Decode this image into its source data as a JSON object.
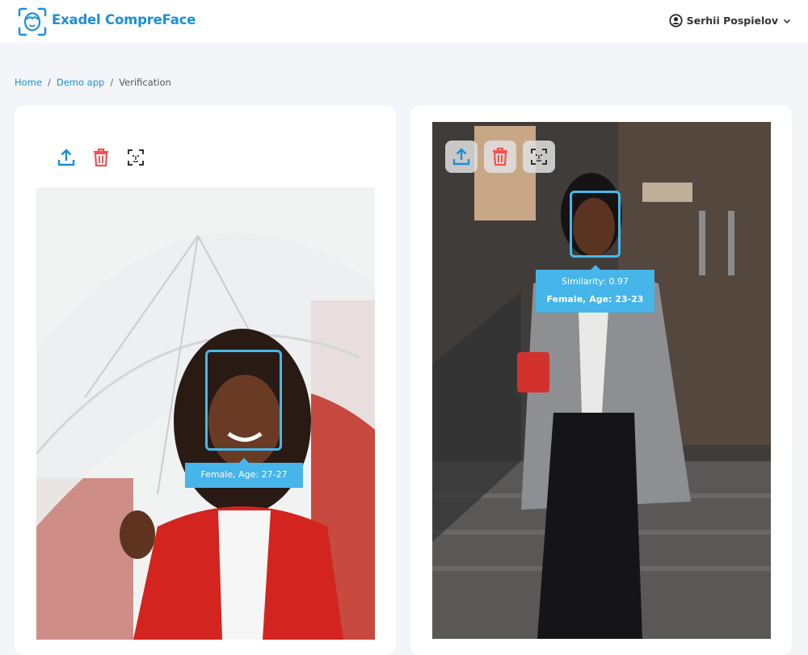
{
  "app": {
    "name": "Exadel CompreFace",
    "brand_color": "#1c8fd8"
  },
  "user": {
    "name": "Serhii Pospielov",
    "icon": "account-circle-icon",
    "menu_icon": "chevron-down-icon"
  },
  "breadcrumb": {
    "items": [
      "Home",
      "Demo app"
    ],
    "separator": "/",
    "current": "Verification"
  },
  "left_panel": {
    "tools": [
      "upload-icon",
      "trash-icon",
      "face-scan-icon"
    ],
    "face_label": "Female, Age: 27-27"
  },
  "right_panel": {
    "tools": [
      "upload-icon",
      "trash-icon",
      "face-scan-icon"
    ],
    "similarity_label": "Similarity: 0.97",
    "face_label": "Female, Age: 23-23"
  },
  "colors": {
    "face_box": "#47b8ed",
    "delete": "#ef5350",
    "upload": "#1c8fd8"
  }
}
